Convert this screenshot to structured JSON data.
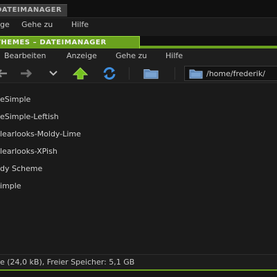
{
  "background_window": {
    "title": "DATEIMANAGER",
    "menu": {
      "item1": "ge",
      "item2": "Gehe zu",
      "item3": "Hilfe"
    }
  },
  "window": {
    "title": "THEMES – DATEIMANAGER",
    "accent_color": "#6aa11e",
    "menu": {
      "bearbeiten": "Bearbeiten",
      "anzeige": "Anzeige",
      "gehe_zu": "Gehe zu",
      "hilfe": "Hilfe"
    },
    "toolbar": {
      "back_icon": "back-arrow-icon",
      "forward_icon": "forward-arrow-icon",
      "history_icon": "chevron-down-icon",
      "up_icon": "go-up-icon",
      "reload_icon": "reload-icon",
      "open_folder_icon": "folder-icon"
    },
    "location": {
      "path": "/home/frederik/"
    },
    "files": [
      "eSimple",
      "eSimple-Leftish",
      "learlooks-Moldy-Lime",
      "learlooks-XPish",
      "dy Scheme",
      "imple"
    ],
    "status": "e (24,0 kB), Freier Speicher: 5,1 GB"
  }
}
